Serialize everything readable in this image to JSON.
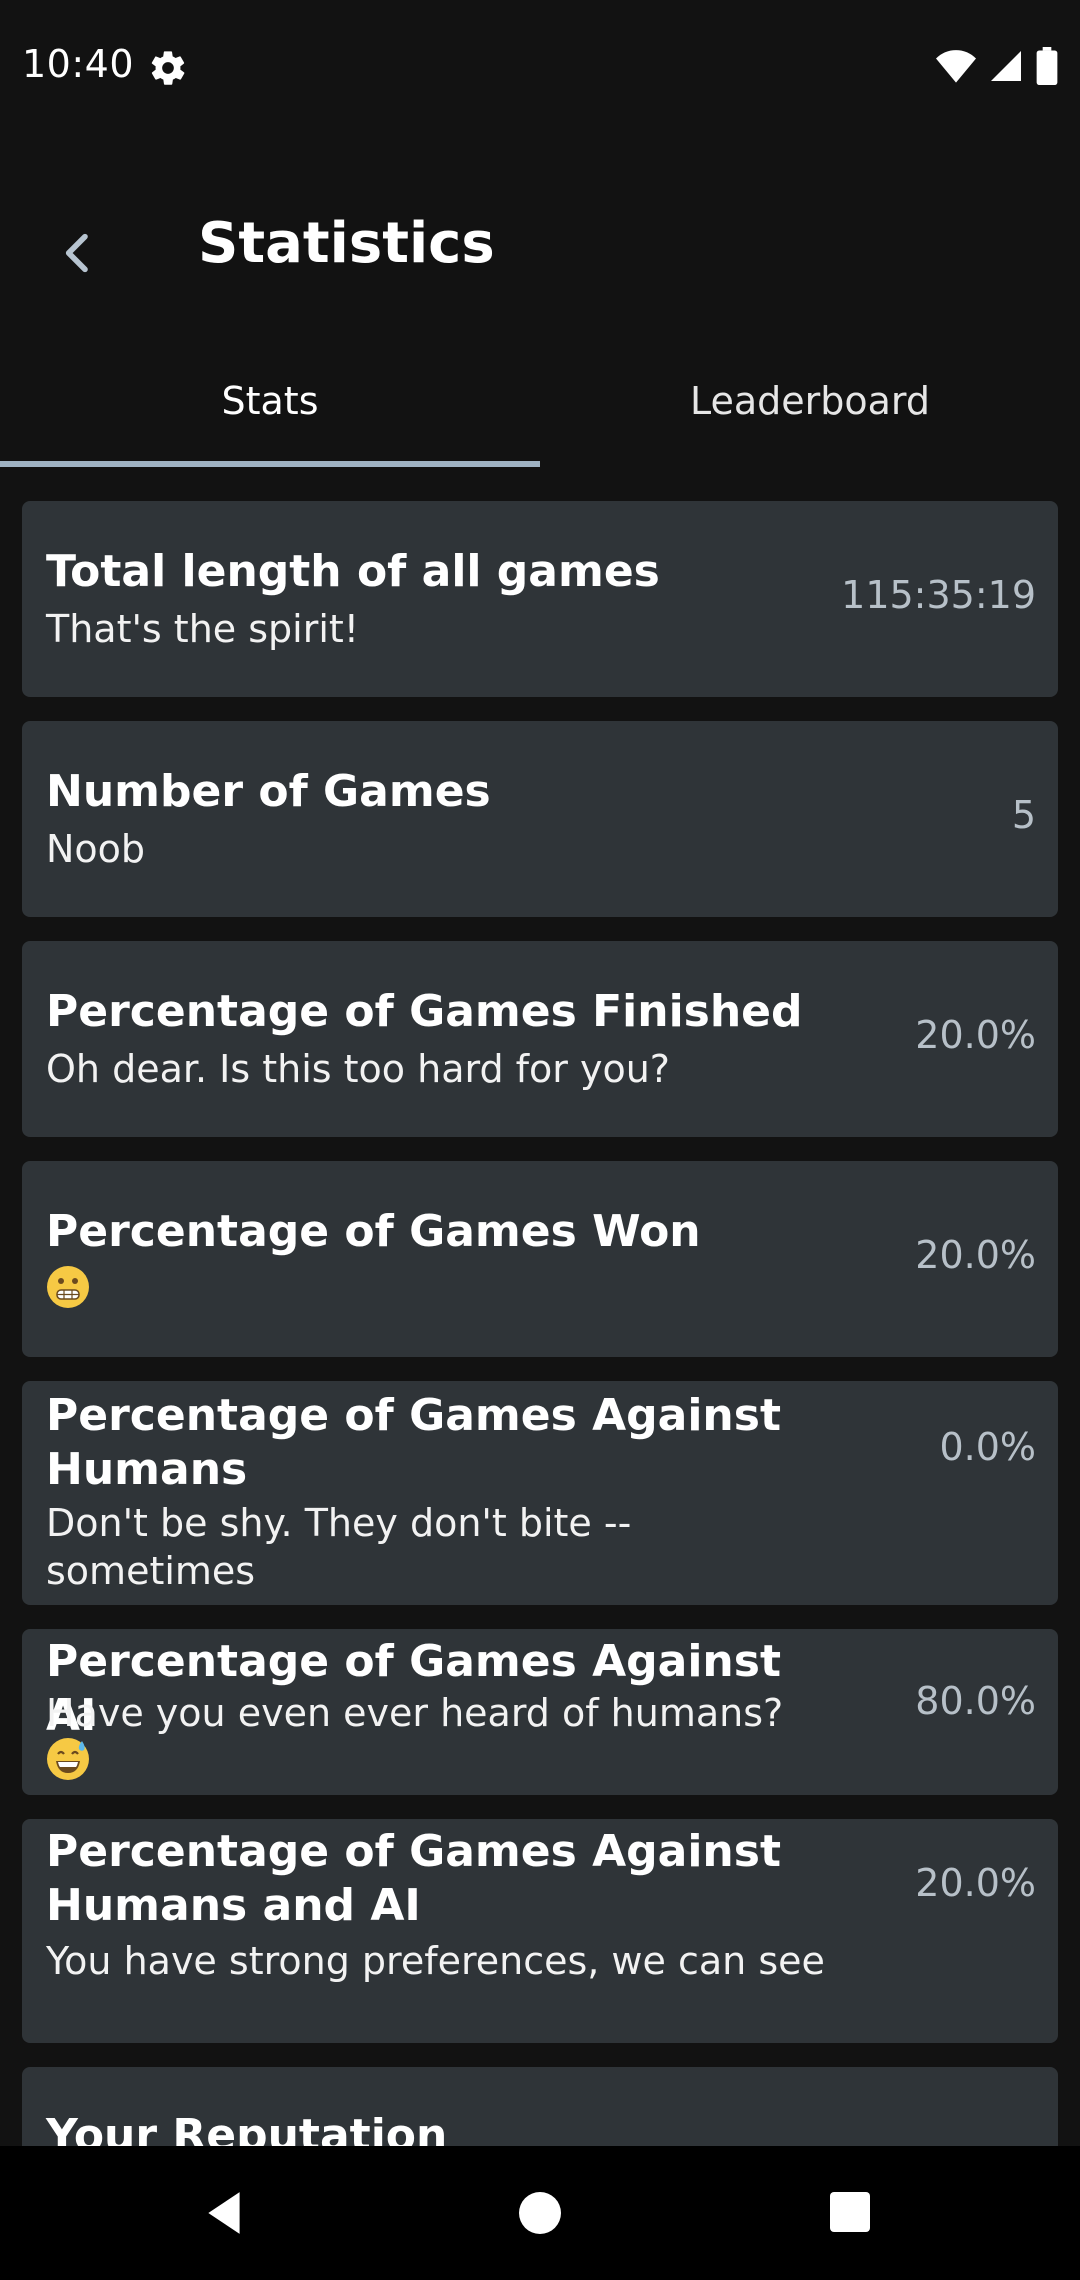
{
  "status_bar": {
    "time": "10:40"
  },
  "app_bar": {
    "title": "Statistics"
  },
  "tabs": [
    {
      "label": "Stats",
      "active": true
    },
    {
      "label": "Leaderboard",
      "active": false
    }
  ],
  "stats": [
    {
      "title": "Total length of all games",
      "subtitle": "That's the spirit!",
      "value": "115:35:19"
    },
    {
      "title": "Number of Games",
      "subtitle": "Noob",
      "value": "5"
    },
    {
      "title": "Percentage of Games Finished",
      "subtitle": "Oh dear. Is this too hard for you?",
      "value": "20.0%"
    },
    {
      "title": "Percentage of Games Won",
      "subtitle": "",
      "value": "20.0%",
      "emoji": "grimacing-face"
    },
    {
      "title": "Percentage of Games Against Humans",
      "subtitle": "Don't be shy. They don't bite -- sometimes",
      "value": "0.0%"
    },
    {
      "title": "Percentage of Games Against AI",
      "subtitle": "Have you even ever heard of humans?",
      "value": "80.0%",
      "emoji": "grinning-sweat-face"
    },
    {
      "title": "Percentage of Games Against Humans and AI",
      "subtitle": "You have strong preferences, we can see",
      "value": "20.0%"
    },
    {
      "title": "Your Reputation",
      "subtitle": "",
      "value": ""
    }
  ],
  "colors": {
    "background": "#121212",
    "card": "#2f3438",
    "accent_indicator": "#9fb2c2",
    "value_text": "#b7c0c8"
  }
}
